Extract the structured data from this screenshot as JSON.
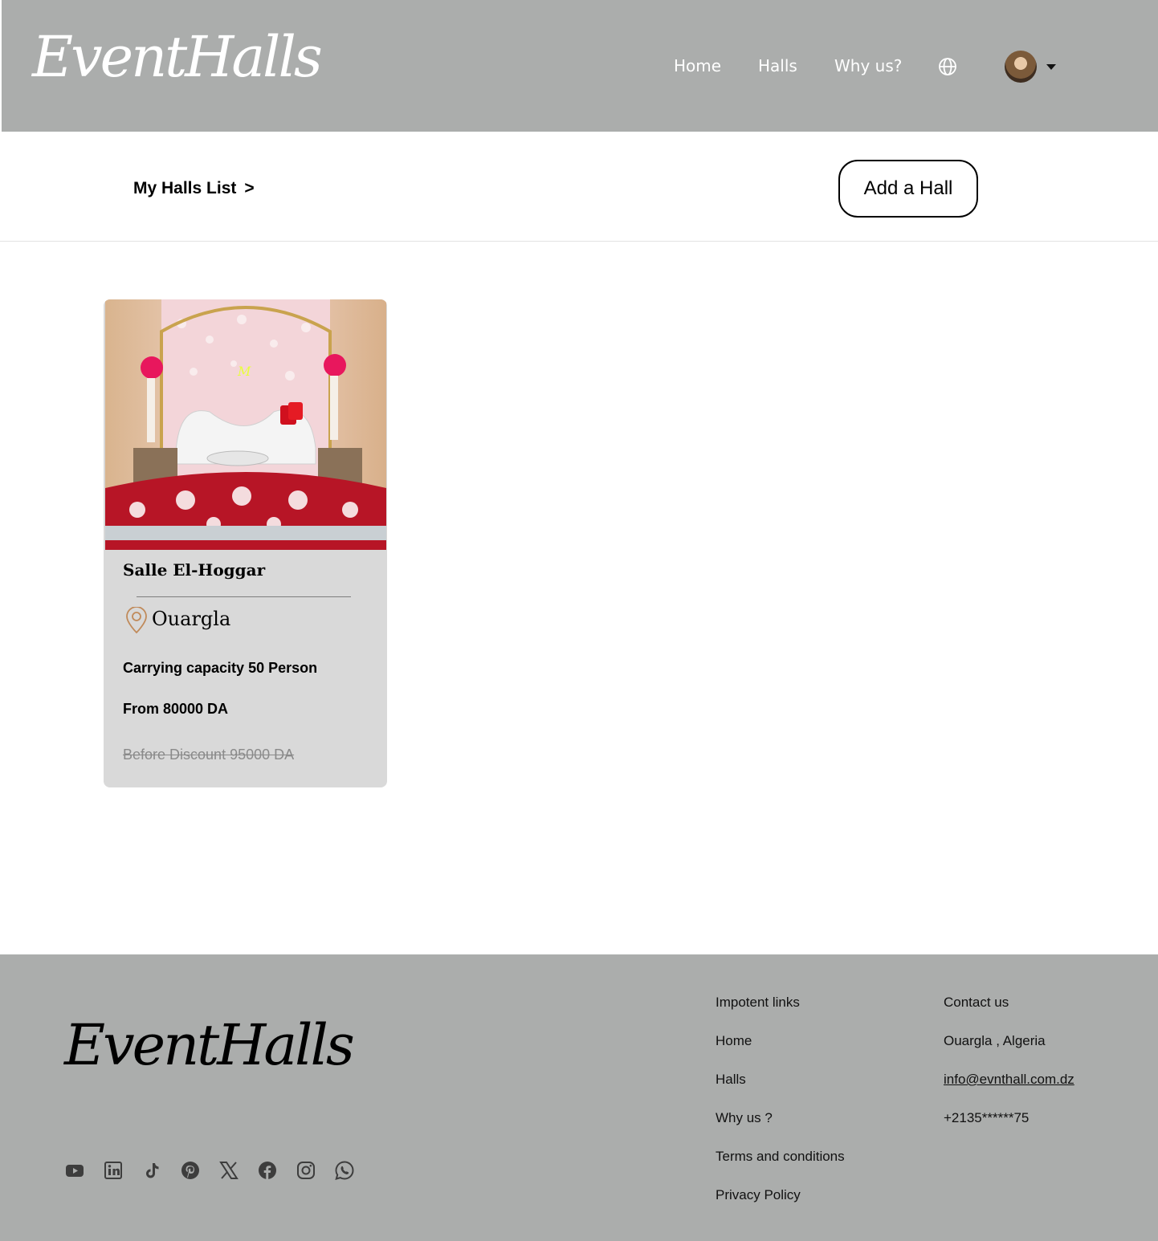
{
  "brand": {
    "logo_text": "EventHalls"
  },
  "nav": {
    "home": "Home",
    "halls": "Halls",
    "why_us": "Why us?"
  },
  "toolbar": {
    "breadcrumb": "My Halls List",
    "breadcrumb_sep": ">",
    "add_hall": "Add a Hall"
  },
  "hall": {
    "name": "Salle El-Hoggar",
    "city": "Ouargla",
    "capacity": "Carrying capacity  50 Person",
    "price": "From 80000 DA",
    "old_price": "Before Discount  95000 DA "
  },
  "footer": {
    "logo_text": "EventHalls",
    "social_icons": [
      "youtube-icon",
      "linkedin-icon",
      "tiktok-icon",
      "pinterest-icon",
      "x-icon",
      "facebook-icon",
      "instagram-icon",
      "whatsapp-icon"
    ],
    "links_title": "Impotent links",
    "links": [
      "Home",
      "Halls",
      "Why us ?",
      "Terms and conditions",
      "Privacy Policy"
    ],
    "contact_title": "Contact us",
    "location": "Ouargla , Algeria",
    "email": "info@evnthall.com.dz",
    "phone": "+2135******75"
  },
  "colors": {
    "header_bg": "#abadac",
    "card_bg": "#d9d9d9",
    "pin_color": "#c08a5a"
  }
}
